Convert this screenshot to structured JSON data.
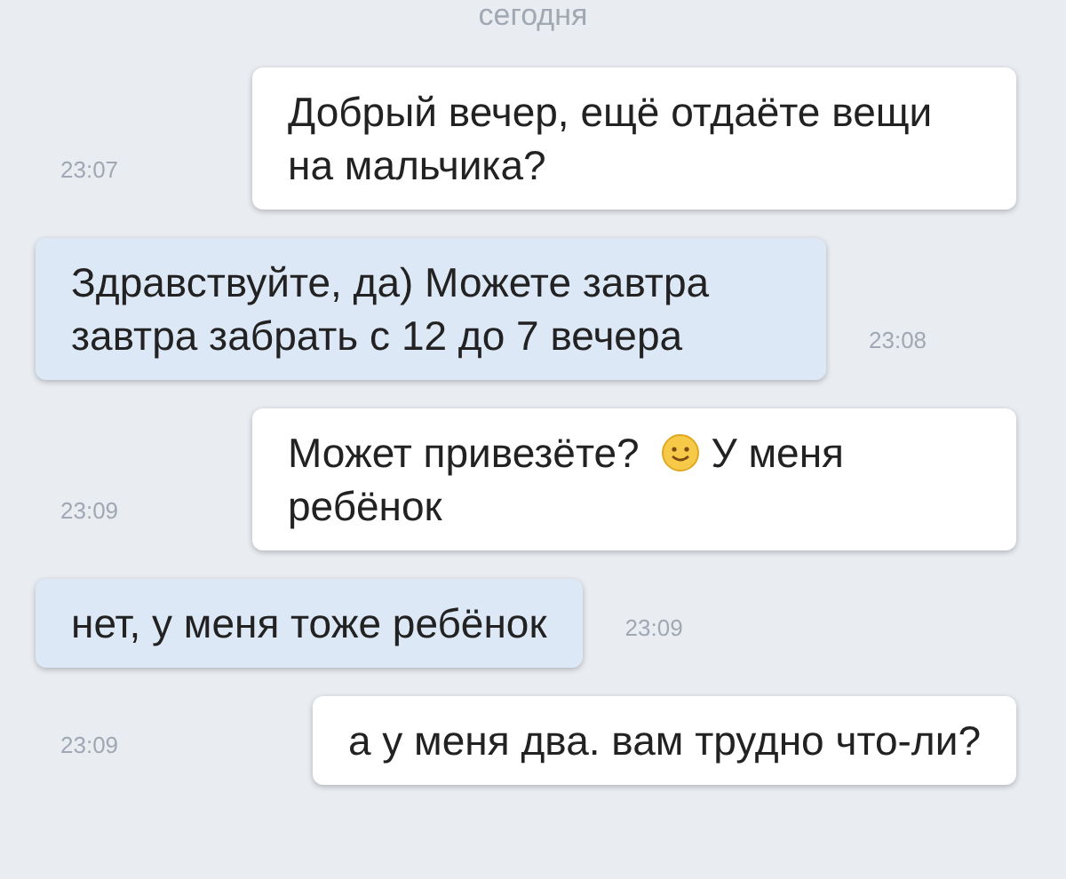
{
  "date_header": "сегодня",
  "messages": [
    {
      "kind": "received",
      "time": "23:07",
      "parts": [
        {
          "kind": "text",
          "text": "Добрый вечер, ещё отдаёте вещи на мальчика?"
        }
      ]
    },
    {
      "kind": "sent",
      "time": "23:08",
      "parts": [
        {
          "kind": "text",
          "text": "Здравствуйте, да) Можете завтра завтра забрать с 12 до 7 вечера"
        }
      ]
    },
    {
      "kind": "received",
      "time": "23:09",
      "parts": [
        {
          "kind": "text",
          "text": "Может привезёте?"
        },
        {
          "kind": "emoji"
        },
        {
          "kind": "text",
          "text": "У меня"
        },
        {
          "kind": "text",
          "text": "ребёнок"
        }
      ]
    },
    {
      "kind": "sent",
      "time": "23:09",
      "parts": [
        {
          "kind": "text",
          "text": "нет, у меня тоже ребёнок"
        }
      ]
    },
    {
      "kind": "received",
      "time": "23:09",
      "parts": [
        {
          "kind": "text",
          "text": "а у меня два. вам трудно что-ли?"
        }
      ]
    }
  ]
}
